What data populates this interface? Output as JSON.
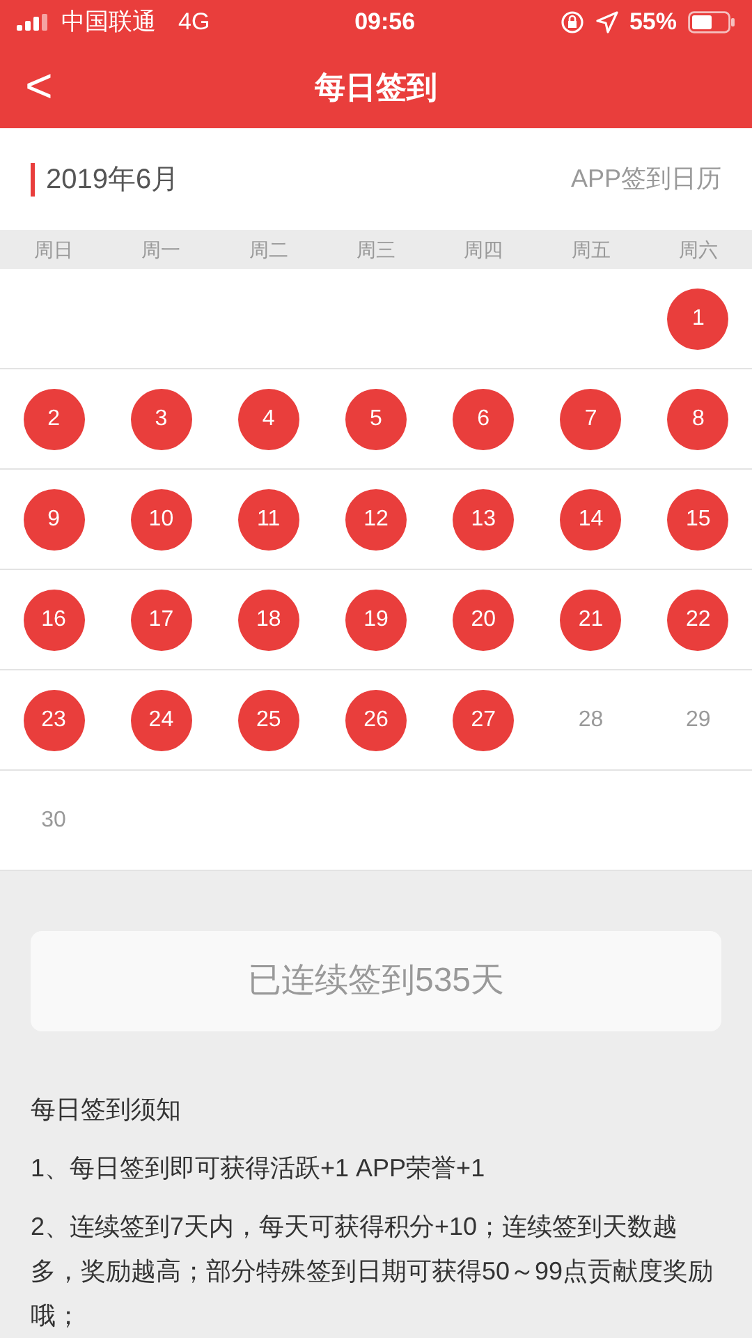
{
  "status_bar": {
    "carrier": "中国联通",
    "network": "4G",
    "time": "09:56",
    "battery": "55%"
  },
  "header": {
    "back": "<",
    "title": "每日签到"
  },
  "month": {
    "label": "2019年6月",
    "link": "APP签到日历"
  },
  "weekdays": [
    "周日",
    "周一",
    "周二",
    "周三",
    "周四",
    "周五",
    "周六"
  ],
  "weeks": [
    {
      "kind": "first",
      "days": [
        {
          "day": "1",
          "signed": true
        }
      ]
    },
    {
      "kind": "week",
      "days": [
        {
          "day": "2",
          "signed": true
        },
        {
          "day": "3",
          "signed": true
        },
        {
          "day": "4",
          "signed": true
        },
        {
          "day": "5",
          "signed": true
        },
        {
          "day": "6",
          "signed": true
        },
        {
          "day": "7",
          "signed": true
        },
        {
          "day": "8",
          "signed": true
        }
      ]
    },
    {
      "kind": "week",
      "days": [
        {
          "day": "9",
          "signed": true
        },
        {
          "day": "10",
          "signed": true
        },
        {
          "day": "11",
          "signed": true
        },
        {
          "day": "12",
          "signed": true
        },
        {
          "day": "13",
          "signed": true
        },
        {
          "day": "14",
          "signed": true
        },
        {
          "day": "15",
          "signed": true
        }
      ]
    },
    {
      "kind": "week",
      "days": [
        {
          "day": "16",
          "signed": true
        },
        {
          "day": "17",
          "signed": true
        },
        {
          "day": "18",
          "signed": true
        },
        {
          "day": "19",
          "signed": true
        },
        {
          "day": "20",
          "signed": true
        },
        {
          "day": "21",
          "signed": true
        },
        {
          "day": "22",
          "signed": true
        }
      ]
    },
    {
      "kind": "week",
      "days": [
        {
          "day": "23",
          "signed": true
        },
        {
          "day": "24",
          "signed": true
        },
        {
          "day": "25",
          "signed": true
        },
        {
          "day": "26",
          "signed": true
        },
        {
          "day": "27",
          "signed": true
        },
        {
          "day": "28",
          "signed": false
        },
        {
          "day": "29",
          "signed": false
        }
      ]
    },
    {
      "kind": "week",
      "days": [
        {
          "day": "30",
          "signed": false
        }
      ]
    }
  ],
  "streak_button": "已连续签到535天",
  "notes": {
    "title": "每日签到须知",
    "items": [
      "1、每日签到即可获得活跃+1 APP荣誉+1",
      "2、连续签到7天内，每天可获得积分+10；连续签到天数越多，奖励越高；部分特殊签到日期可获得50～99点贡献度奖励哦；"
    ]
  }
}
